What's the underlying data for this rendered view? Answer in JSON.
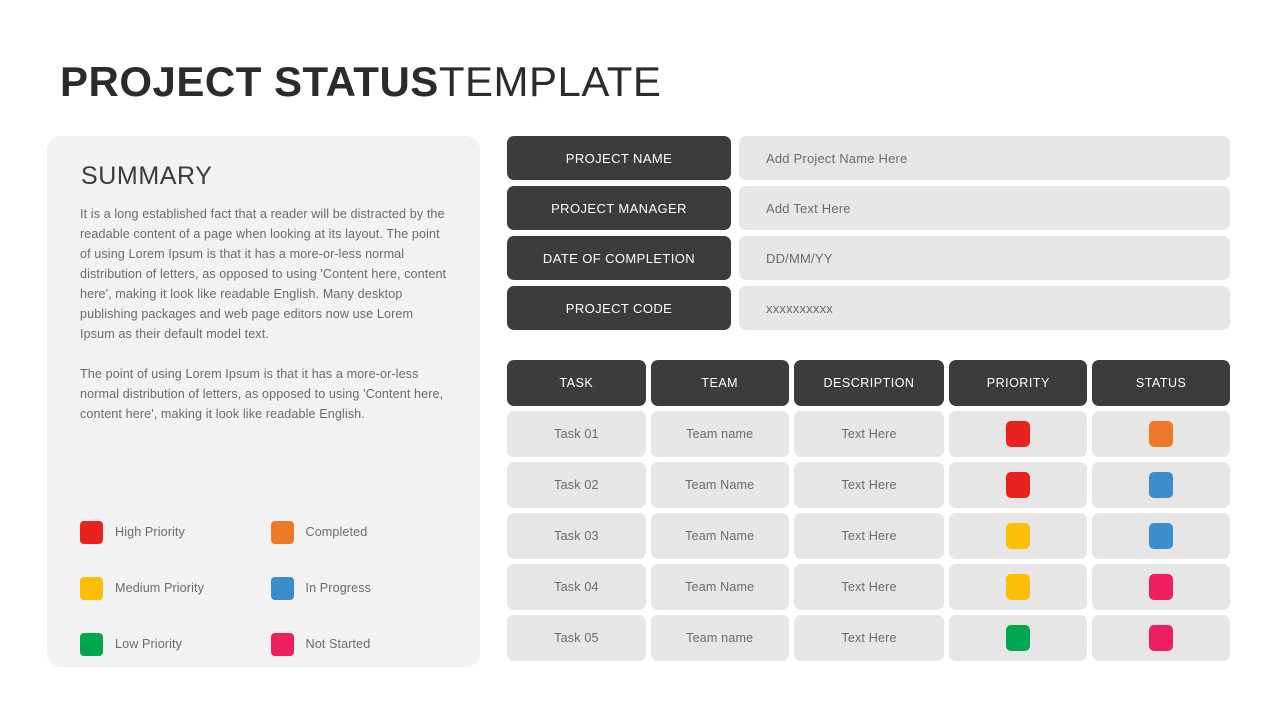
{
  "title": {
    "bold": "PROJECT STATUS",
    "light": "TEMPLATE"
  },
  "summary": {
    "heading": "SUMMARY",
    "paragraphs": [
      "It is a long established fact that a reader will be distracted by the readable content of a page when looking at its layout.  The point of using Lorem Ipsum is that it has a more-or-less normal distribution of letters, as opposed to using 'Content here, content here', making it look like readable English. Many desktop publishing packages and web page editors now use Lorem Ipsum as their default model text.",
      "The point of using Lorem Ipsum is that it has a more-or-less normal distribution of letters, as opposed to using 'Content here, content here', making it look like readable English."
    ]
  },
  "legend": {
    "items": [
      {
        "label": "High Priority",
        "color": "#e8221f"
      },
      {
        "label": "Completed",
        "color": "#ee7a29"
      },
      {
        "label": "Medium Priority",
        "color": "#fcbf07"
      },
      {
        "label": "In Progress",
        "color": "#3d8dcc"
      },
      {
        "label": "Low Priority",
        "color": "#00a650"
      },
      {
        "label": "Not Started",
        "color": "#ee1e5f"
      }
    ]
  },
  "project_info": {
    "rows": [
      {
        "label": "PROJECT NAME",
        "value": "Add Project Name Here"
      },
      {
        "label": "PROJECT MANAGER",
        "value": "Add Text Here"
      },
      {
        "label": "DATE OF COMPLETION",
        "value": "DD/MM/YY"
      },
      {
        "label": "PROJECT CODE",
        "value": "xxxxxxxxxx"
      }
    ]
  },
  "task_table": {
    "headers": [
      "TASK",
      "TEAM",
      "DESCRIPTION",
      "PRIORITY",
      "STATUS"
    ],
    "rows": [
      {
        "task": "Task 01",
        "team": "Team name",
        "description": "Text Here",
        "priority_color": "#e8221f",
        "status_color": "#ee7a29"
      },
      {
        "task": "Task 02",
        "team": "Team Name",
        "description": "Text Here",
        "priority_color": "#e8221f",
        "status_color": "#3d8dcc"
      },
      {
        "task": "Task 03",
        "team": "Team Name",
        "description": "Text Here",
        "priority_color": "#fcbf07",
        "status_color": "#3d8dcc"
      },
      {
        "task": "Task 04",
        "team": "Team Name",
        "description": "Text Here",
        "priority_color": "#fcbf07",
        "status_color": "#ee1e5f"
      },
      {
        "task": "Task 05",
        "team": "Team name",
        "description": "Text Here",
        "priority_color": "#00a650",
        "status_color": "#ee1e5f"
      }
    ]
  },
  "colors": {
    "dark": "#3c3c3b",
    "panel": "#f2f2f2",
    "cell": "#e6e6e6",
    "background": "#ffffff"
  }
}
